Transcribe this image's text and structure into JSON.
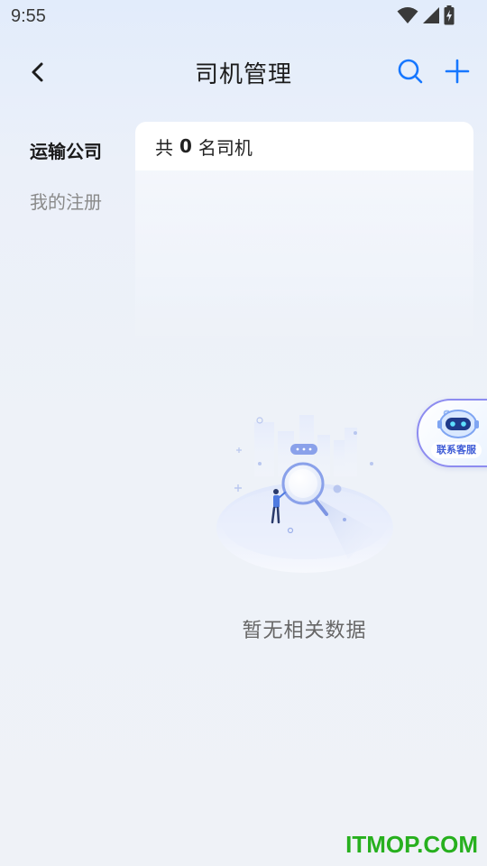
{
  "status_bar": {
    "time": "9:55",
    "icons": [
      "wifi-icon",
      "signal-icon",
      "battery-charging-icon"
    ]
  },
  "header": {
    "title": "司机管理",
    "back_icon": "chevron-left-icon",
    "search_icon": "search-icon",
    "add_icon": "plus-icon",
    "accent_color": "#1677ff"
  },
  "side_menu": {
    "items": [
      {
        "label": "运输公司",
        "active": true
      },
      {
        "label": "我的注册",
        "active": false
      }
    ]
  },
  "driver_count": {
    "prefix": "共",
    "count": "0",
    "suffix": "名司机"
  },
  "empty_state": {
    "text": "暂无相关数据",
    "icon": "empty-search-illustration"
  },
  "customer_service": {
    "label": "联系客服",
    "icon": "robot-icon"
  },
  "watermark": {
    "text": "ITMOP.COM",
    "color": "#27b01e"
  }
}
